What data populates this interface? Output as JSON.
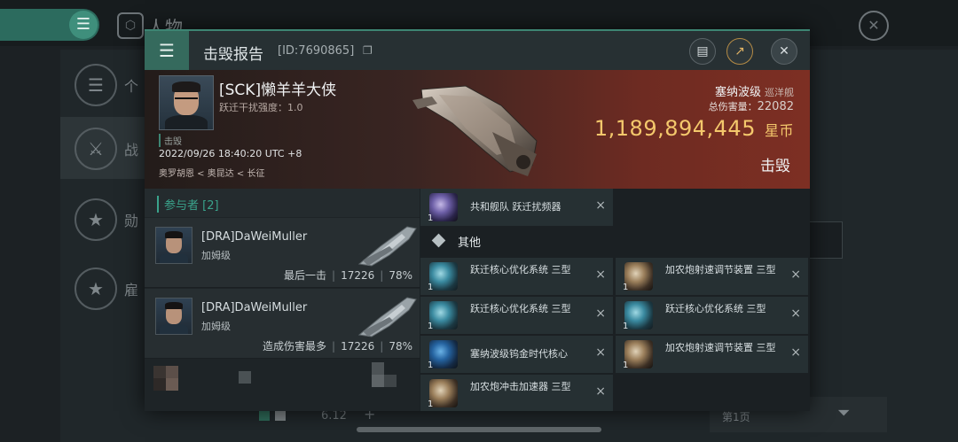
{
  "background": {
    "title": "人物",
    "menu_icon": "list-icon",
    "side_items": [
      {
        "label": "个",
        "icon": "list-icon"
      },
      {
        "label": "战",
        "icon": "crossed-swords-icon"
      },
      {
        "label": "勋",
        "icon": "star-badge-icon"
      },
      {
        "label": "雇",
        "icon": "star-badge-icon"
      }
    ],
    "bottom_number": "6.12",
    "bottom_plus": "+",
    "page_label": "第1页",
    "filter_icon": "filter-icon"
  },
  "dialog": {
    "title": "击毁报告",
    "report_id": "[ID:7690865]",
    "copy_icon": "copy-icon",
    "buttons": {
      "clipboard_icon": "clipboard-icon",
      "share_icon": "share-icon",
      "close_icon": "close-icon"
    }
  },
  "victim": {
    "name": "[SCK]懒羊羊大侠",
    "warp_strength_label": "跃迁干扰强度：1.0",
    "kill_tag": "击毁",
    "time": "2022/09/26 18:40:20 UTC +8",
    "location": "奥罗胡恩 < 奥昆达 < 长征",
    "ship_name": "塞纳波级",
    "ship_class": "巡洋舰",
    "total_damage_label": "总伤害量：",
    "total_damage_value": "22082",
    "isk_value": "1,189,894,445",
    "isk_unit": "星币",
    "status": "击毁"
  },
  "participants": {
    "header": "参与者 [2]",
    "rows": [
      {
        "name": "[DRA]DaWeiMuller",
        "ship": "加姆级",
        "role": "最后一击",
        "damage": "17226",
        "percent": "78%"
      },
      {
        "name": "[DRA]DaWeiMuller",
        "ship": "加姆级",
        "role": "造成伤害最多",
        "damage": "17226",
        "percent": "78%"
      }
    ]
  },
  "items": {
    "top_item": {
      "qty": "1",
      "name": "共和舰队 跃迁扰频器",
      "icon": "scrambler-icon"
    },
    "section_title": "其他",
    "grid": [
      {
        "qty": "1",
        "name": "跃迁核心优化系统 三型",
        "icon": "warp-core-icon"
      },
      {
        "qty": "1",
        "name": "加农炮射速调节装置 三型",
        "icon": "gun-rig-icon"
      },
      {
        "qty": "1",
        "name": "跃迁核心优化系统 三型",
        "icon": "warp-core-icon"
      },
      {
        "qty": "1",
        "name": "跃迁核心优化系统 三型",
        "icon": "warp-core-icon"
      },
      {
        "qty": "1",
        "name": "塞纳波级钨金时代核心",
        "icon": "ship-core-icon"
      },
      {
        "qty": "1",
        "name": "加农炮射速调节装置 三型",
        "icon": "gun-rig-icon"
      },
      {
        "qty": "1",
        "name": "加农炮冲击加速器 三型",
        "icon": "gun-rig-icon"
      }
    ],
    "remove_glyph": "×"
  }
}
